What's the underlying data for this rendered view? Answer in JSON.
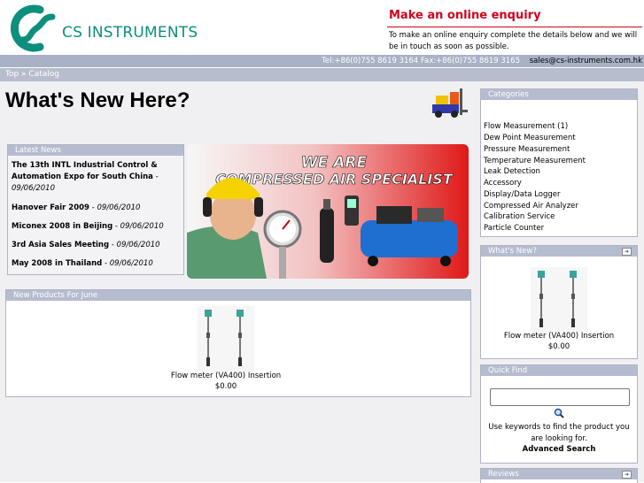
{
  "header": {
    "brand": "CS INSTRUMENTS",
    "enquiry_title": "Make an online enquiry",
    "enquiry_text": "To make an online enquiry complete the details below and we will be in touch as soon as possible."
  },
  "contact": {
    "phones": "Tel:+86(0)755 8619 3164 Fax:+86(0)755 8619 3165",
    "email": "sales@cs-instruments.com.hk"
  },
  "breadcrumb": "Top » Catalog",
  "page_title": "What's New Here?",
  "latest_news": {
    "title": "Latest News",
    "items": [
      {
        "title": "The 13th INTL Industrial Control & Automation Expo for South China",
        "date": "09/06/2010"
      },
      {
        "title": "Hanover Fair 2009",
        "date": "09/06/2010"
      },
      {
        "title": "Miconex 2008 in Beijing",
        "date": "09/06/2010"
      },
      {
        "title": "3rd Asia Sales Meeting",
        "date": "09/06/2010"
      },
      {
        "title": "May 2008 in Thailand",
        "date": "09/06/2010"
      }
    ]
  },
  "banner": {
    "line1": "WE ARE",
    "line2": "COMPRESSED AIR SPECIALIST"
  },
  "new_products": {
    "title": "New Products For June",
    "product_name": "Flow meter (VA400) Insertion",
    "product_price": "$0.00"
  },
  "categories": {
    "title": "Categories",
    "items": [
      "Flow Measurement (1)",
      "Dew Point Measurement",
      "Pressure Measurement",
      "Temperature Measurement",
      "Leak Detection",
      "Accessory",
      "Display/Data Logger",
      "Compressed Air Analyzer",
      "Calibration Service",
      "Particle Counter"
    ]
  },
  "whats_new": {
    "title": "What's New?",
    "product_name": "Flow meter (VA400) Insertion",
    "product_price": "$0.00"
  },
  "quick_find": {
    "title": "Quick Find",
    "search_value": "",
    "help_text": "Use keywords to find the product you are looking for.",
    "advanced": "Advanced Search"
  },
  "reviews": {
    "title": "Reviews"
  },
  "colors": {
    "brand_teal": "#0c8f7c",
    "enquiry_red": "#d0021b",
    "box_header": "#b6bcd0",
    "bar_gray": "#a9b1c6"
  }
}
